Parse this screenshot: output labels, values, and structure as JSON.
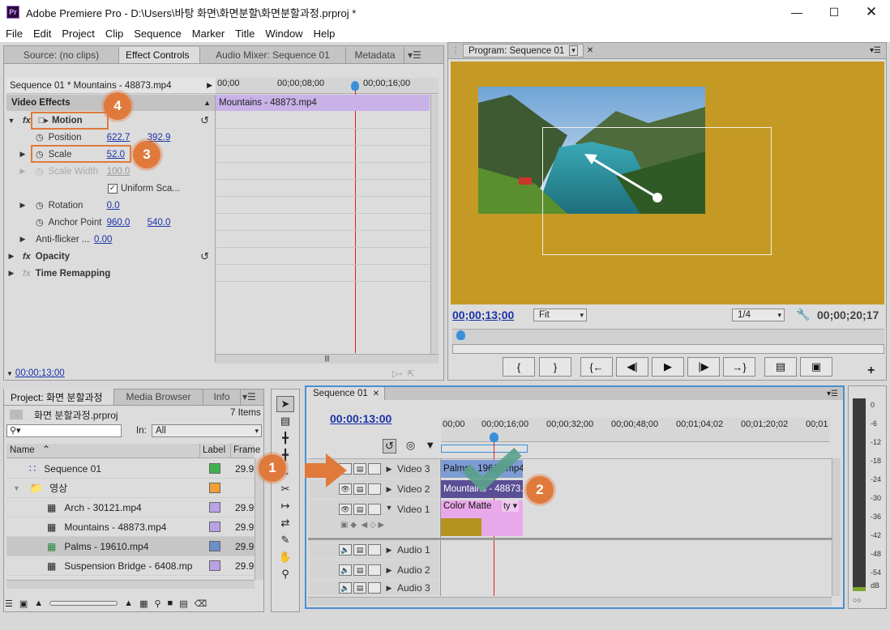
{
  "app": {
    "title": "Adobe Premiere Pro - D:\\Users\\바탕 화면\\화면분할\\화면분할과정.prproj *",
    "logo": "Pr"
  },
  "menu": [
    "File",
    "Edit",
    "Project",
    "Clip",
    "Sequence",
    "Marker",
    "Title",
    "Window",
    "Help"
  ],
  "source_tabs": [
    "Source: (no clips)",
    "Effect Controls",
    "Audio Mixer: Sequence 01",
    "Metadata"
  ],
  "effect_controls": {
    "clip_title": "Sequence 01 * Mountains - 48873.mp4",
    "ruler": [
      "00;00",
      "00;00;08;00",
      "00;00;16;00"
    ],
    "clip_bar": "Mountains - 48873.mp4",
    "section": "Video Effects",
    "motion": "Motion",
    "position_label": "Position",
    "position_x": "622.7",
    "position_y": "392.9",
    "scale_label": "Scale",
    "scale_value": "52.0",
    "scale_width_label": "Scale Width",
    "scale_width_value": "100.0",
    "uniform_label": "Uniform Sca...",
    "rotation_label": "Rotation",
    "rotation_value": "0.0",
    "anchor_label": "Anchor Point",
    "anchor_x": "960.0",
    "anchor_y": "540.0",
    "antiflicker_label": "Anti-flicker ...",
    "antiflicker_value": "0.00",
    "opacity": "Opacity",
    "time_remap": "Time Remapping",
    "timecode": "00;00;13;00"
  },
  "program": {
    "tab": "Program: Sequence 01",
    "timecode": "00;00;13;00",
    "fit": "Fit",
    "quality": "1/4",
    "duration": "00;00;20;17",
    "bg_color": "#c49a24"
  },
  "project": {
    "tabs": [
      "Project: 화면 분할과정",
      "Media Browser",
      "Info"
    ],
    "file": "화면 분할과정.prproj",
    "count": "7 Items",
    "in_label": "In:",
    "in_value": "All",
    "cols": [
      "Name",
      "Label",
      "Frame"
    ],
    "items": [
      {
        "name": "Sequence 01",
        "fr": "29.9",
        "color": "#3fb24f"
      },
      {
        "name": "영상",
        "fr": "",
        "color": "#f0a030"
      },
      {
        "name": "Arch - 30121.mp4",
        "fr": "29.9",
        "color": "#b9a1e6"
      },
      {
        "name": "Mountains - 48873.mp4",
        "fr": "29.9",
        "color": "#b9a1e6"
      },
      {
        "name": "Palms - 19610.mp4",
        "fr": "29.9",
        "color": "#6a8fc9"
      },
      {
        "name": "Suspension Bridge - 6408.mp4",
        "fr": "29.9",
        "color": "#b9a1e6"
      }
    ]
  },
  "timeline": {
    "tab": "Sequence 01",
    "timecode": "00:00:13:00",
    "ruler": [
      "00;00",
      "00;00;16;00",
      "00;00;32;00",
      "00;00;48;00",
      "00;01;04;02",
      "00;01;20;02",
      "00;01"
    ],
    "tracks": [
      "Video 3",
      "Video 2",
      "Video 1",
      "Audio 1",
      "Audio 2",
      "Audio 3"
    ],
    "clip_v3": "Palms - 19610.mp4",
    "clip_v2": "Mountains - 48873.",
    "clip_v1": "Color Matte",
    "clip_v1_fx": "ty"
  },
  "vu": [
    "0",
    "-6",
    "-12",
    "-18",
    "-24",
    "-30",
    "-36",
    "-42",
    "-48",
    "-54",
    "dB"
  ],
  "badges": [
    "1",
    "2",
    "3",
    "4"
  ]
}
